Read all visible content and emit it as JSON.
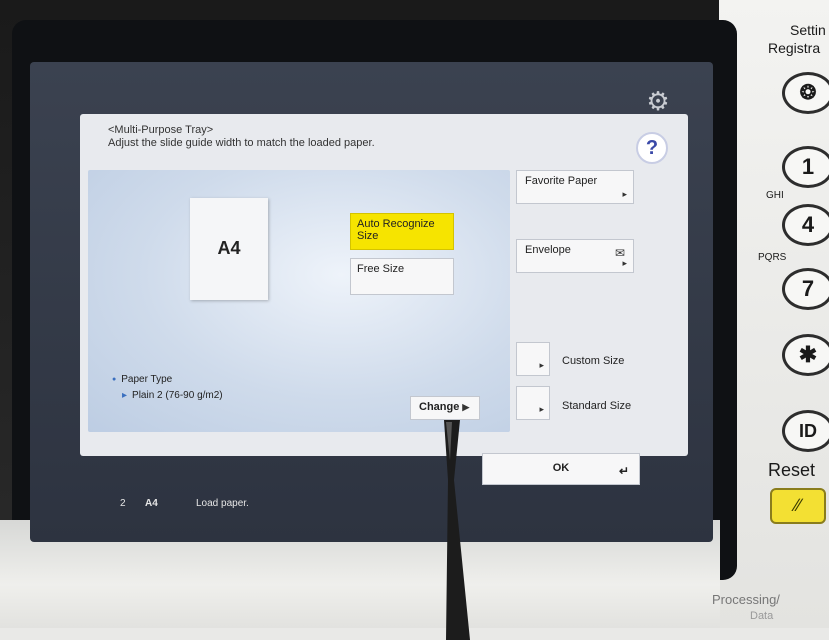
{
  "dialog": {
    "title": "<Multi-Purpose Tray>",
    "subtitle": "Adjust the slide guide width to match the loaded paper.",
    "help_label": "?"
  },
  "paper_preview": {
    "size": "A4"
  },
  "buttons": {
    "auto_recognize": "Auto Recognize Size",
    "free_size": "Free Size",
    "favorite_paper": "Favorite Paper",
    "envelope": "Envelope",
    "custom_size": "Custom Size",
    "standard_size": "Standard Size",
    "change": "Change",
    "ok": "OK"
  },
  "paper_type": {
    "label": "Paper Type",
    "value": "Plain 2 (76-90 g/m2)"
  },
  "status_bar": {
    "tray": "2",
    "size": "A4",
    "message": "Load paper."
  },
  "hardware": {
    "settings_label_1": "Settin",
    "settings_label_2": "Registra",
    "key_1": "1",
    "key_4": "4",
    "key_7": "7",
    "key_star": "✱",
    "key_id": "ID",
    "label_ghi": "GHI",
    "label_pqrs": "PQRS",
    "reset_label": "Reset",
    "processing_label": "Processing/",
    "data_label": "Data"
  },
  "colors": {
    "accent_yellow": "#f6e400",
    "help_blue": "#3a49a8"
  }
}
